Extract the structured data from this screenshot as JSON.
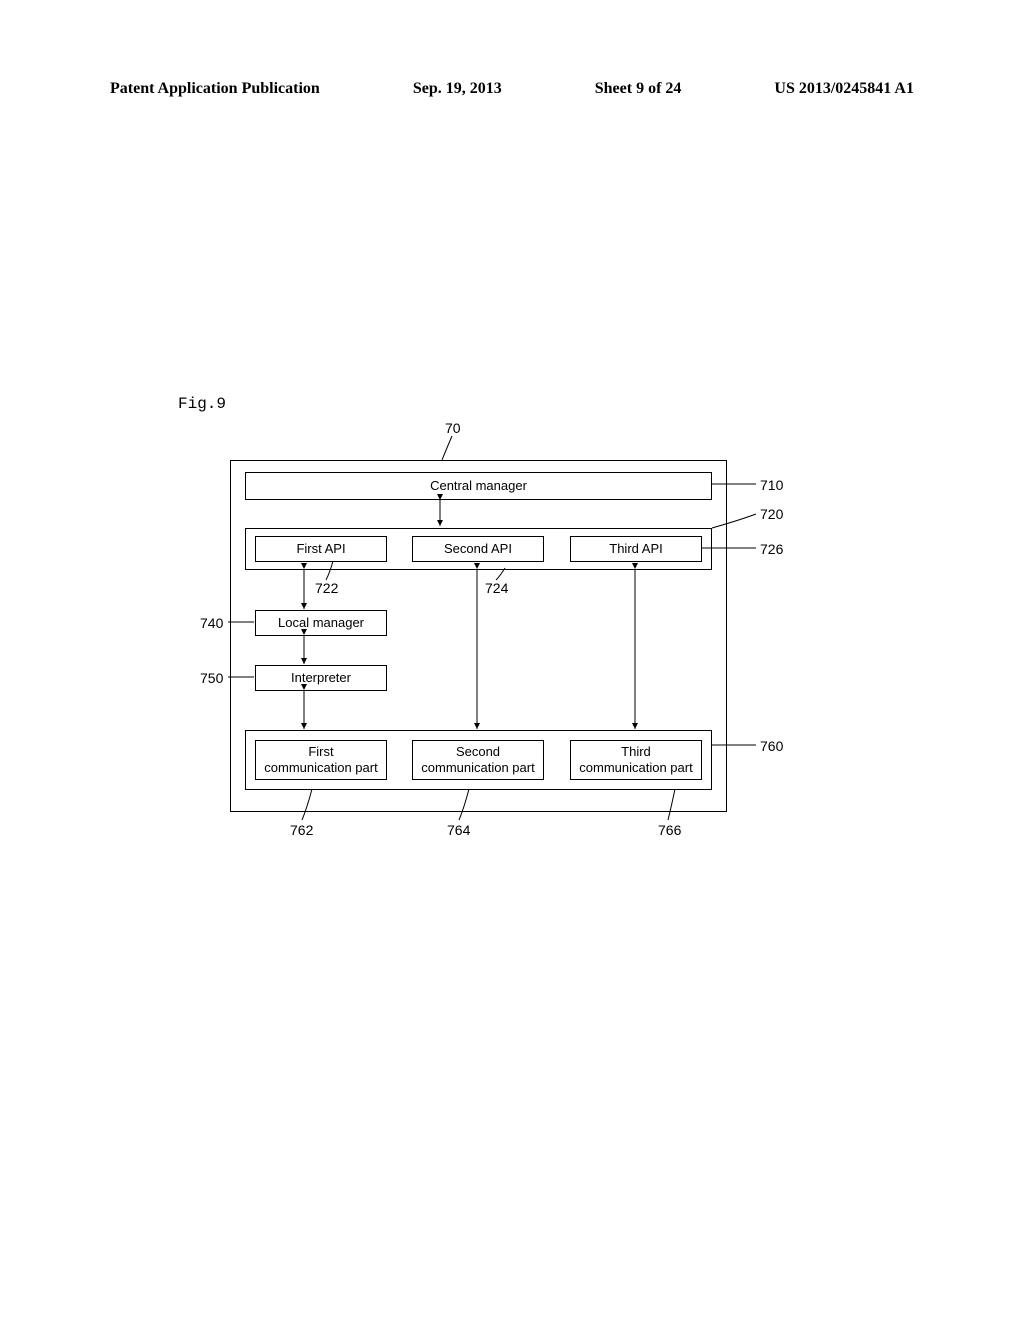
{
  "header": {
    "publication": "Patent Application Publication",
    "date": "Sep. 19, 2013",
    "sheet": "Sheet 9 of 24",
    "pubnum": "US 2013/0245841 A1"
  },
  "figure_label": "Fig.9",
  "blocks": {
    "central_manager": "Central manager",
    "first_api": "First API",
    "second_api": "Second API",
    "third_api": "Third API",
    "local_manager": "Local manager",
    "interpreter": "Interpreter",
    "first_comm": "First\ncommunication part",
    "second_comm": "Second\ncommunication part",
    "third_comm": "Third\ncommunication part"
  },
  "refs": {
    "r70": "70",
    "r710": "710",
    "r720": "720",
    "r722": "722",
    "r724": "724",
    "r726": "726",
    "r740": "740",
    "r750": "750",
    "r760": "760",
    "r762": "762",
    "r764": "764",
    "r766": "766"
  }
}
